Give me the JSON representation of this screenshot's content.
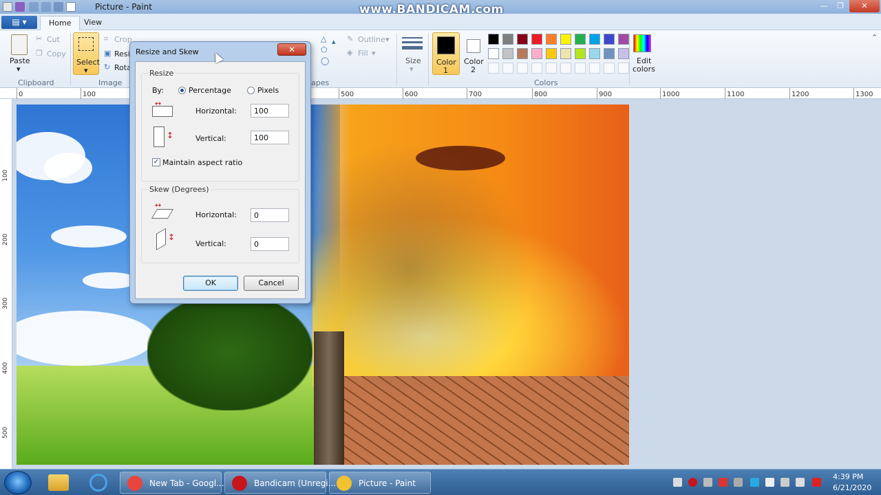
{
  "window": {
    "title": "Picture - Paint",
    "watermark": "www.BANDICAM.com",
    "controls": {
      "minimize": "—",
      "maximize": "❐",
      "close": "✕"
    }
  },
  "ribbon": {
    "tabs": [
      {
        "label": "Home",
        "active": true
      },
      {
        "label": "View",
        "active": false
      }
    ],
    "file_tab": "▤ ▾",
    "clipboard": {
      "paste": "Paste",
      "cut": "Cut",
      "copy": "Copy",
      "group": "Clipboard"
    },
    "image": {
      "select": "Select",
      "crop": "Crop",
      "resize": "Resiz",
      "rotate": "Rota",
      "group": "Image"
    },
    "shapes": {
      "outline": "Outline",
      "fill": "Fill",
      "group": "apes"
    },
    "size": "Size",
    "color1": {
      "label": "Color",
      "num": "1",
      "value": "#000000"
    },
    "color2": {
      "label": "Color",
      "num": "2",
      "value": "#ffffff"
    },
    "colors_group": "Colors",
    "edit_colors": {
      "line1": "Edit",
      "line2": "colors"
    },
    "palette_row1": [
      "#000000",
      "#7f7f7f",
      "#880015",
      "#ed1c24",
      "#ff7f27",
      "#fff200",
      "#22b14c",
      "#00a2e8",
      "#3f48cc",
      "#a349a4"
    ],
    "palette_row2": [
      "#ffffff",
      "#c3c3c3",
      "#b97a57",
      "#ffaec9",
      "#ffc90e",
      "#efe4b0",
      "#b5e61d",
      "#99d9ea",
      "#7092be",
      "#c8bfe7"
    ]
  },
  "ruler": {
    "h": [
      "0",
      "100",
      "500",
      "600",
      "700",
      "800",
      "900",
      "1000",
      "1100",
      "1200",
      "1300"
    ],
    "v": [
      "100",
      "200",
      "300",
      "400",
      "500"
    ]
  },
  "dialog": {
    "title": "Resize and Skew",
    "close": "✕",
    "resize_legend": "Resize",
    "by": "By:",
    "percentage": "Percentage",
    "pixels": "Pixels",
    "percentage_selected": true,
    "horizontal": "Horizontal:",
    "vertical": "Vertical:",
    "resize_h": "100",
    "resize_v": "100",
    "maintain": "Maintain aspect ratio",
    "maintain_checked": true,
    "skew_legend": "Skew (Degrees)",
    "skew_h": "0",
    "skew_v": "0",
    "ok": "OK",
    "cancel": "Cancel"
  },
  "taskbar": {
    "items": [
      {
        "label": "New Tab - Googl...",
        "icon": "chrome-icon",
        "color": "#e8453c"
      },
      {
        "label": "Bandicam (Unregi...",
        "icon": "bandicam-icon",
        "color": "#c8151b"
      },
      {
        "label": "Picture - Paint",
        "icon": "paint-icon",
        "color": "#f2c230"
      }
    ],
    "time": "4:39 PM",
    "date": "6/21/2020"
  }
}
